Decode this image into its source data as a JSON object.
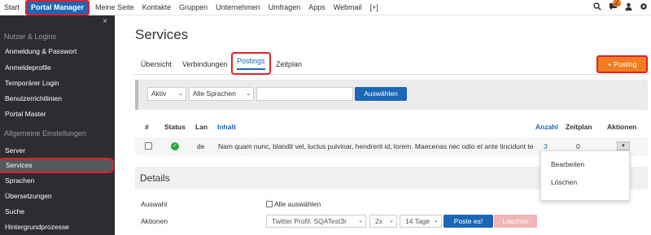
{
  "topnav": {
    "items": [
      "Start",
      "Portal Manager",
      "Meine Seite",
      "Kontakte",
      "Gruppen",
      "Unternehmen",
      "Umfragen",
      "Apps",
      "Webmail",
      "[+]"
    ],
    "active_index": 1,
    "notification_count": "2",
    "icons": [
      "search-icon",
      "chat-icon",
      "user-icon",
      "settings-icon"
    ]
  },
  "sidebar": {
    "close": "×",
    "section1": "Nutzer & Logins",
    "section1_items": [
      "Anmeldung & Passwort",
      "Anmeldeprofile",
      "Temporärer Login",
      "Benutzerrichtlinien",
      "Portal Master"
    ],
    "section2": "Allgemeine Einstellungen",
    "section2_items": [
      "Server",
      "Services",
      "Sprachen",
      "Übersetzungen",
      "Suche",
      "Hintergrundprozesse"
    ],
    "active_item": "Services"
  },
  "main": {
    "title": "Services",
    "tabs": [
      "Übersicht",
      "Verbindungen",
      "Postings",
      "Zeitplan"
    ],
    "active_tab": "Postings",
    "posting_button": "+ Posting",
    "filter": {
      "status_select": "Aktiv",
      "language_select": "Alle Sprachen",
      "search_value": "",
      "apply_button": "Auswählen"
    },
    "table": {
      "headers": [
        "#",
        "Status",
        "Lan",
        "Inhalt",
        "Anzahl",
        "Zeitplan",
        "Aktionen"
      ],
      "rows": [
        {
          "lang": "de",
          "content": "Nam quam nunc, blandit vel, luctus pulvinar, hendrerit id, lorem. Maecenas nec odio et ante tincidunt tempus.",
          "count": "3",
          "schedule": "0"
        }
      ]
    },
    "row_menu": [
      "Bearbeiten",
      "Löschen"
    ],
    "details": {
      "heading": "Details",
      "selection_label": "Auswahl",
      "select_all": "Alle auswählen",
      "actions_label": "Aktionen",
      "profile_select": "Twitter Profil: SQATest3r",
      "times_select": "2x",
      "days_select": "14 Tage",
      "post_button": "Poste es!",
      "delete_button": "Löschen"
    }
  },
  "colors": {
    "accent_blue": "#1b67b5",
    "orange": "#f07d1f",
    "highlight_red": "#e0202a",
    "sidebar_bg": "#2b2d31",
    "success_green": "#28a745"
  }
}
